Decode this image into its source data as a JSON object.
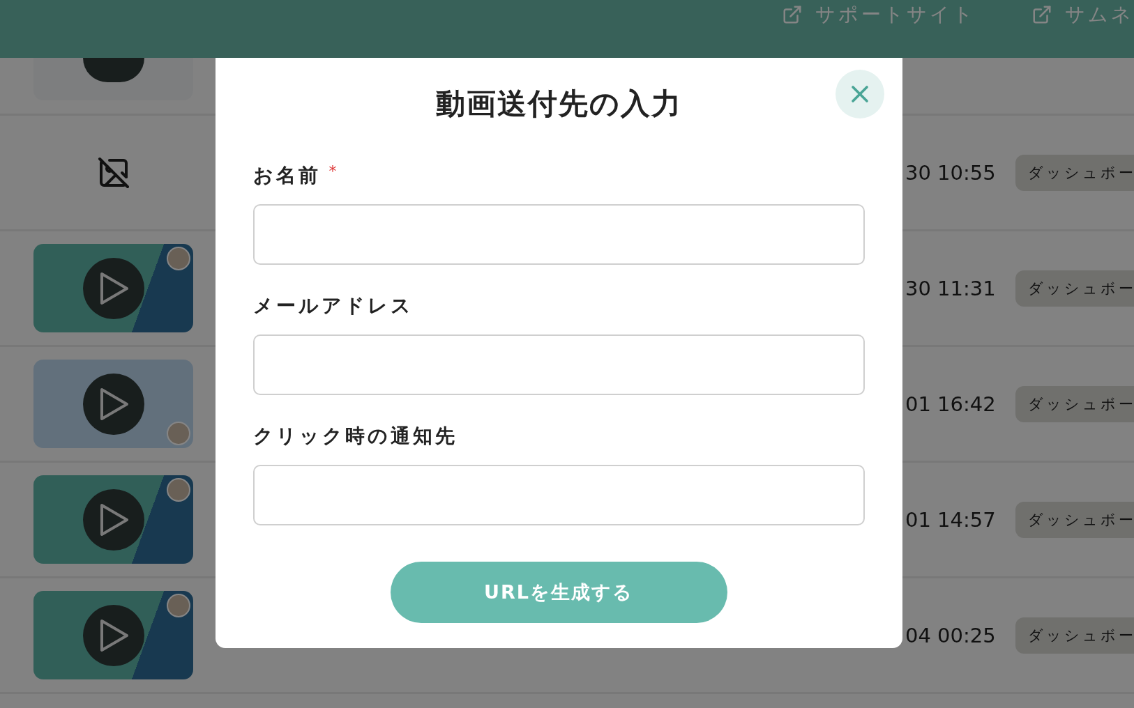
{
  "header": {
    "links": [
      {
        "label": "サポートサイト"
      },
      {
        "label": "サムネ"
      }
    ]
  },
  "rows": [
    {
      "kind": "screenshot"
    },
    {
      "kind": "none",
      "time": "30 10:55",
      "action": "ダッシュボー"
    },
    {
      "kind": "teal",
      "time": "30 11:31",
      "action": "ダッシュボー"
    },
    {
      "kind": "light",
      "time": "01 16:42",
      "action": "ダッシュボー"
    },
    {
      "kind": "teal",
      "time": "01 14:57",
      "action": "ダッシュボー"
    },
    {
      "kind": "teal",
      "time": "04 00:25",
      "action": "ダッシュボー"
    }
  ],
  "dialog": {
    "title": "動画送付先の入力",
    "fields": [
      {
        "label": "お名前",
        "required_mark": "*"
      },
      {
        "label": "メールアドレス"
      },
      {
        "label": "クリック時の通知先"
      }
    ],
    "submit": "URLを生成する"
  }
}
